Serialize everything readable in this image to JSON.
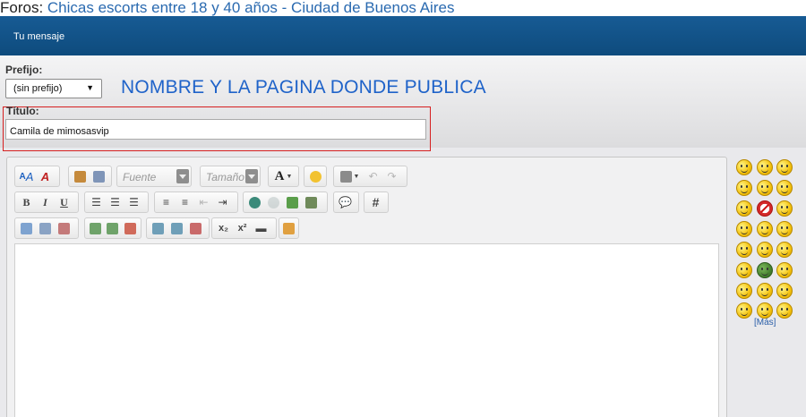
{
  "forum_header": {
    "prefix": "Foros: ",
    "forum_name": "Chicas escorts entre 18 y 40 años - Ciudad de Buenos Aires"
  },
  "titlebar": {
    "label": "Tu mensaje"
  },
  "form": {
    "prefix_label": "Prefijo:",
    "prefix_value": "(sin prefijo)",
    "annotation": "NOMBRE Y LA PAGINA DONDE PUBLICA",
    "title_label": "Título:",
    "title_value": "Camila de mimosasvip"
  },
  "toolbar": {
    "font_placeholder": "Fuente",
    "size_placeholder": "Tamaño",
    "font_color_label": "A",
    "hash_label": "#",
    "bold_label": "B",
    "italic_label": "I",
    "underline_label": "U",
    "subscript_label": "x₂",
    "superscript_label": "x²"
  },
  "smilies": {
    "more_label": "[Más]"
  },
  "colors": {
    "titlebar": "#0e4b7d",
    "annotation": "#1f63c9",
    "highlight_frame": "#d62020",
    "link": "#2a6ab0"
  }
}
